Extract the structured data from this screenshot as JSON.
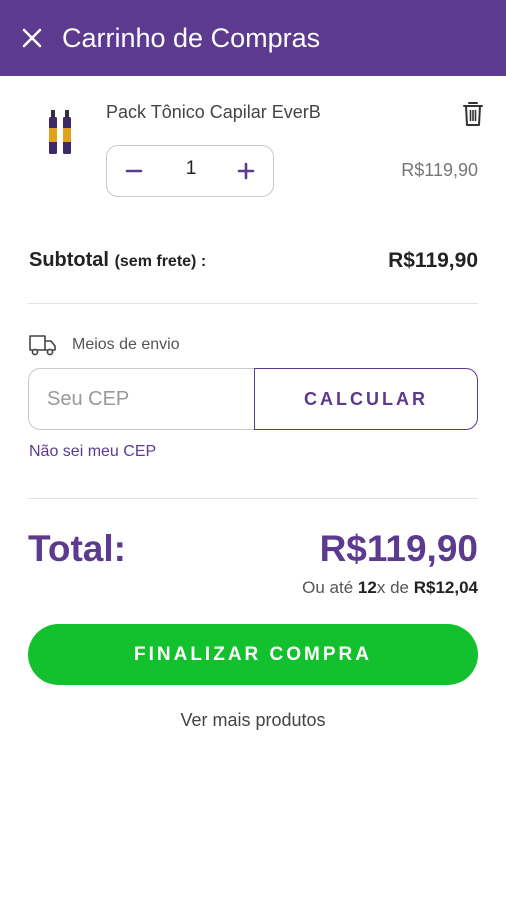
{
  "header": {
    "title": "Carrinho de Compras",
    "close_icon": "close-icon"
  },
  "cart": {
    "items": [
      {
        "name": "Pack Tônico Capilar EverB",
        "quantity": "1",
        "price": "R$119,90",
        "image_icon": "product-bottles-icon"
      }
    ],
    "subtotal_label": "Subtotal",
    "subtotal_note": "(sem frete) :",
    "subtotal_value": "R$119,90"
  },
  "shipping": {
    "label": "Meios de envio",
    "icon": "truck-icon",
    "cep_placeholder": "Seu CEP",
    "cep_value": "",
    "calculate_label": "CALCULAR",
    "unknown_cep_link": "Não sei meu CEP"
  },
  "total": {
    "label": "Total:",
    "value": "R$119,90",
    "installments_prefix": "Ou até",
    "installments_count": "12",
    "installments_mid": "x de",
    "installments_amount": "R$12,04"
  },
  "actions": {
    "checkout_label": "FINALIZAR COMPRA",
    "more_products_label": "Ver mais produtos"
  },
  "colors": {
    "brand": "#5b3a8f",
    "checkout": "#13c12e"
  }
}
